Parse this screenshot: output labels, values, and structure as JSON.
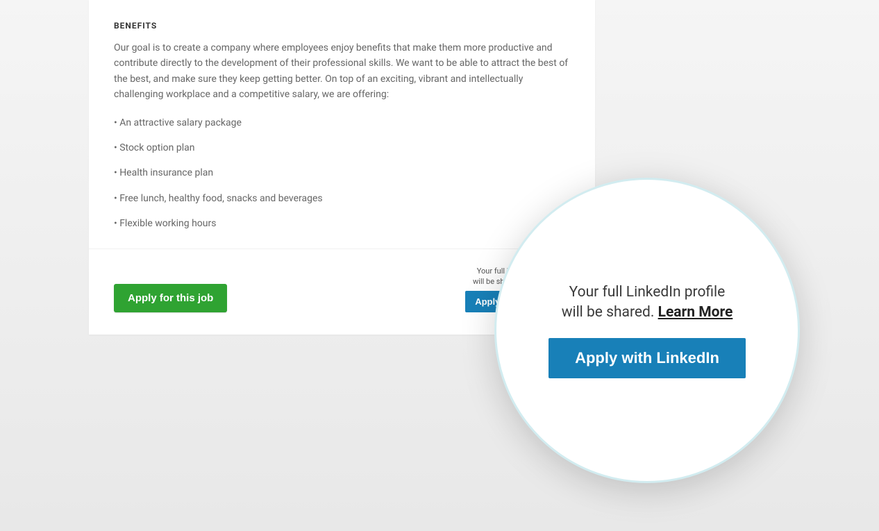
{
  "benefits": {
    "heading": "BENEFITS",
    "intro": "Our goal is to create a company where employees enjoy benefits that make them more productive and contribute directly to the development of their professional skills. We want to be able to attract the best of the best, and make sure they keep getting better. On top of an exciting, vibrant and intellectually challenging workplace and a competitive salary, we are offering:",
    "items": [
      "• An attractive salary package",
      "• Stock option plan",
      "• Health insurance plan",
      "• Free lunch, healthy food, snacks and beverages",
      "• Flexible working hours"
    ]
  },
  "apply_button_label": "Apply for this job",
  "linkedin_small": {
    "note_line1": "Your full LinkedIn profile",
    "note_line2_prefix": "will be shared. ",
    "learn_more": "Learn More",
    "button_label": "Apply with LinkedIn"
  },
  "zoom": {
    "line1": "Your full LinkedIn profile",
    "line2_prefix": "will be shared. ",
    "learn_more": "Learn More",
    "button_label": "Apply with LinkedIn"
  }
}
